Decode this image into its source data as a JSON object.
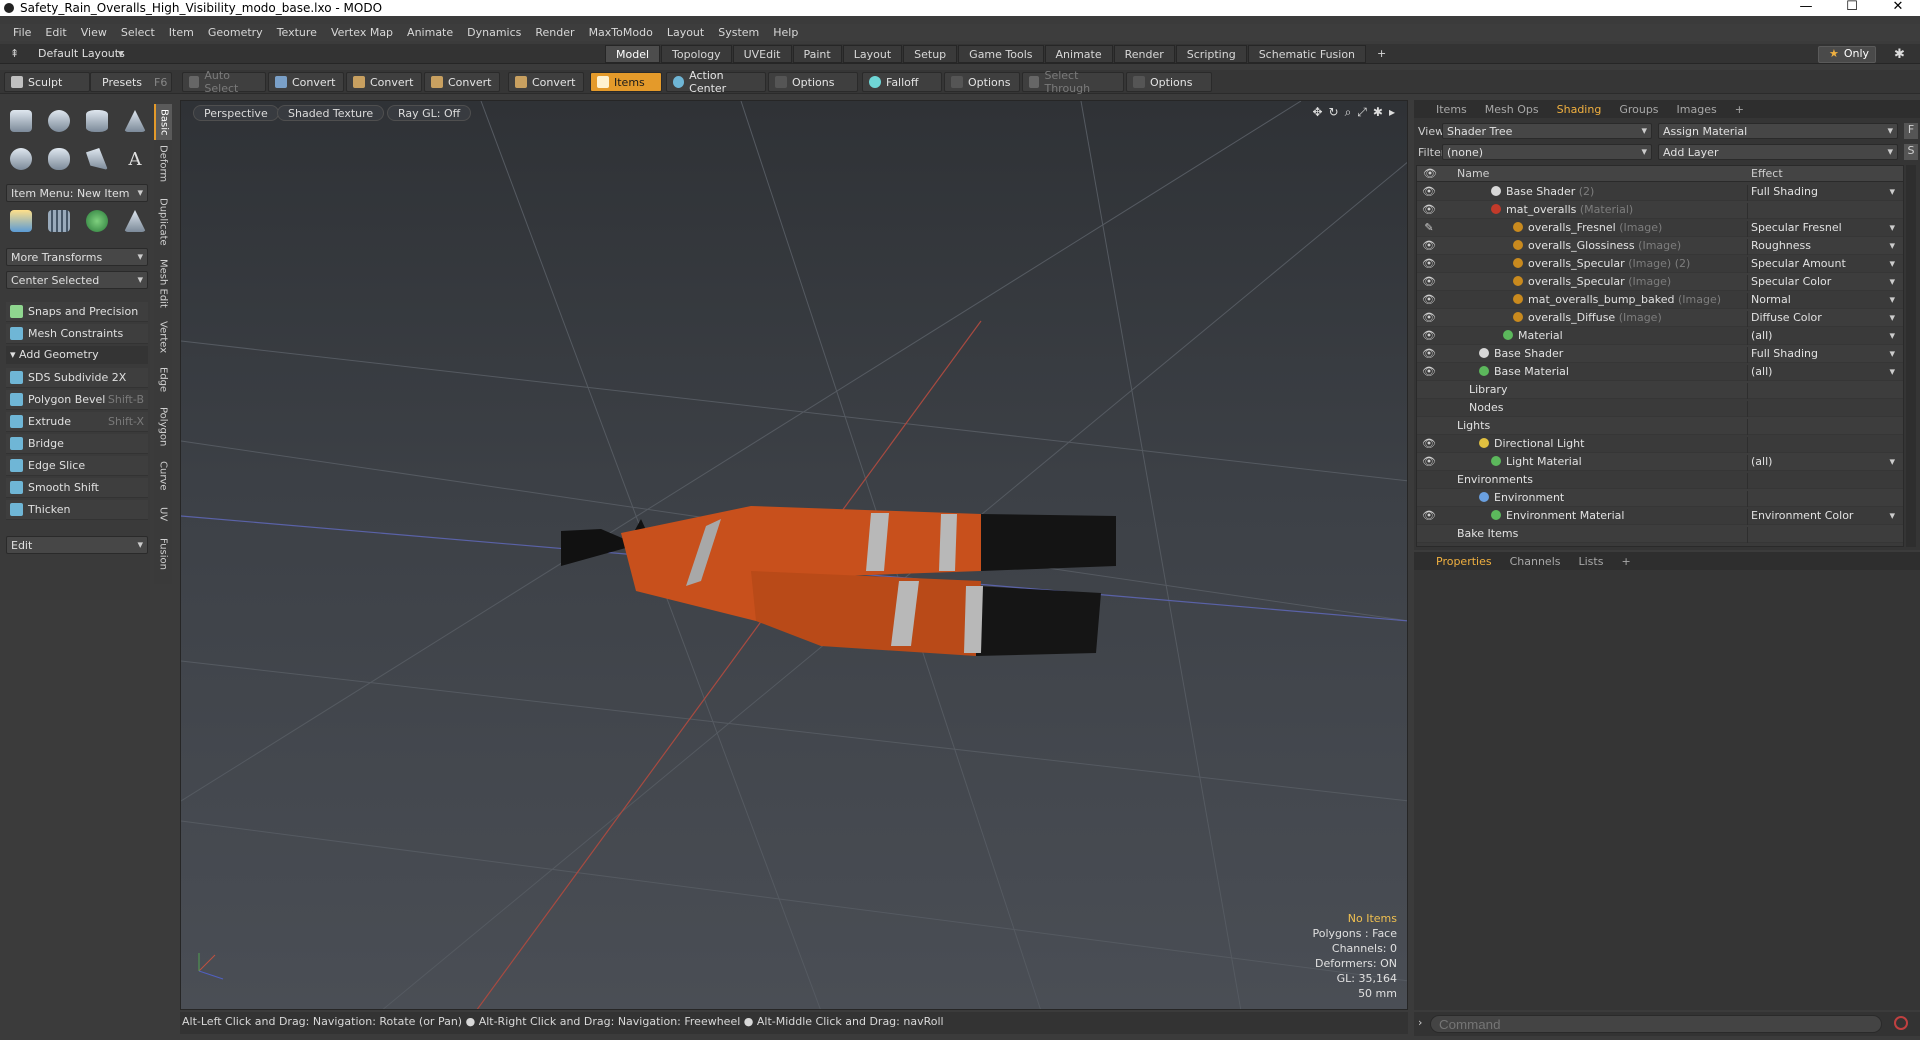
{
  "window": {
    "title": "Safety_Rain_Overalls_High_Visibility_modo_base.lxo - MODO",
    "controls": [
      "—",
      "☐",
      "✕"
    ]
  },
  "menu": [
    "File",
    "Edit",
    "View",
    "Select",
    "Item",
    "Geometry",
    "Texture",
    "Vertex Map",
    "Animate",
    "Dynamics",
    "Render",
    "MaxToModo",
    "Layout",
    "System",
    "Help"
  ],
  "layoutbar": {
    "layout_name": "Default Layouts",
    "tabs": [
      "Model",
      "Topology",
      "UVEdit",
      "Paint",
      "Layout",
      "Setup",
      "Game Tools",
      "Animate",
      "Render",
      "Scripting",
      "Schematic Fusion"
    ],
    "active_tab": "Model",
    "add": "+",
    "only_label": "Only",
    "only_star": "★",
    "gear": "✱"
  },
  "toolbar": {
    "sculpt": "Sculpt",
    "presets": "Presets",
    "presets_key": "F6",
    "auto_select": "Auto Select",
    "convert1": "Convert",
    "convert2": "Convert",
    "convert3": "Convert",
    "convert4": "Convert",
    "items": "Items",
    "action_center": "Action Center",
    "options1": "Options",
    "falloff": "Falloff",
    "options2": "Options",
    "select_through": "Select Through",
    "options3": "Options"
  },
  "left": {
    "vtabs": [
      "Basic",
      "Deform",
      "Duplicate",
      "Mesh Edit",
      "Vertex",
      "Edge",
      "Polygon",
      "Curve",
      "UV",
      "Fusion"
    ],
    "item_menu": "Item Menu: New Item",
    "more_transforms": "More Transforms",
    "center_selected": "Center Selected",
    "snaps": "Snaps and Precision",
    "mesh_constraints": "Mesh Constraints",
    "add_geometry": "Add Geometry",
    "tools": [
      {
        "label": "SDS Subdivide 2X",
        "key": ""
      },
      {
        "label": "Polygon Bevel",
        "key": "Shift-B"
      },
      {
        "label": "Extrude",
        "key": "Shift-X"
      },
      {
        "label": "Bridge",
        "key": ""
      },
      {
        "label": "Edge Slice",
        "key": ""
      },
      {
        "label": "Smooth Shift",
        "key": ""
      },
      {
        "label": "Thicken",
        "key": ""
      }
    ],
    "edit": "Edit"
  },
  "viewport": {
    "perspective": "Perspective",
    "shaded": "Shaded Texture",
    "raygl": "Ray GL: Off",
    "icons": [
      "✥",
      "↻",
      "⌕",
      "⤢",
      "✱",
      "▸"
    ],
    "info": {
      "items": "No Items",
      "polygons": "Polygons : Face",
      "channels": "Channels: 0",
      "deformers": "Deformers: ON",
      "gl": "GL: 35,164",
      "lens": "50 mm"
    }
  },
  "status": "Alt-Left Click and Drag: Navigation: Rotate (or Pan) ● Alt-Right Click and Drag: Navigation: Freewheel ● Alt-Middle Click and Drag: navRoll",
  "right": {
    "tabs": [
      "Items",
      "Mesh Ops",
      "Shading",
      "Groups",
      "Images",
      "+"
    ],
    "active_tab": "Shading",
    "view_label": "View",
    "view_value": "Shader Tree",
    "assign": "Assign Material",
    "filter_label": "Filter",
    "filter_value": "(none)",
    "add_layer": "Add Layer",
    "f_btn": "F",
    "s_btn": "S",
    "col_name": "Name",
    "col_effect": "Effect",
    "rows": [
      {
        "name": "Base Shader",
        "sub": "(2)",
        "effect": "Full Shading",
        "eye": "👁",
        "ball": "#d8d8d8",
        "indent": 74
      },
      {
        "name": "mat_overalls",
        "sub": "(Material)",
        "effect": "",
        "eye": "👁",
        "ball": "#c23a2a",
        "indent": 74
      },
      {
        "name": "overalls_Fresnel",
        "sub": "(Image)",
        "effect": "Specular Fresnel",
        "eye": "✎",
        "ball": "#c98a1e",
        "indent": 96
      },
      {
        "name": "overalls_Glossiness",
        "sub": "(Image)",
        "effect": "Roughness",
        "eye": "👁",
        "ball": "#c98a1e",
        "indent": 96
      },
      {
        "name": "overalls_Specular",
        "sub": "(Image) (2)",
        "effect": "Specular Amount",
        "eye": "👁",
        "ball": "#c98a1e",
        "indent": 96
      },
      {
        "name": "overalls_Specular",
        "sub": "(Image)",
        "effect": "Specular Color",
        "eye": "👁",
        "ball": "#c98a1e",
        "indent": 96
      },
      {
        "name": "mat_overalls_bump_baked",
        "sub": "(Image)",
        "effect": "Normal",
        "eye": "👁",
        "ball": "#c98a1e",
        "indent": 96
      },
      {
        "name": "overalls_Diffuse",
        "sub": "(Image)",
        "effect": "Diffuse Color",
        "eye": "👁",
        "ball": "#c98a1e",
        "indent": 96
      },
      {
        "name": "Material",
        "sub": "",
        "effect": "(all)",
        "eye": "👁",
        "ball": "#5cb85c",
        "indent": 86
      },
      {
        "name": "Base Shader",
        "sub": "",
        "effect": "Full Shading",
        "eye": "👁",
        "ball": "#d8d8d8",
        "indent": 62
      },
      {
        "name": "Base Material",
        "sub": "",
        "effect": "(all)",
        "eye": "👁",
        "ball": "#5cb85c",
        "indent": 62
      },
      {
        "name": "Library",
        "sub": "",
        "effect": "",
        "eye": "",
        "ball": "",
        "indent": 52
      },
      {
        "name": "Nodes",
        "sub": "",
        "effect": "",
        "eye": "",
        "ball": "",
        "indent": 52
      },
      {
        "name": "Lights",
        "sub": "",
        "effect": "",
        "eye": "",
        "ball": "",
        "indent": 40
      },
      {
        "name": "Directional Light",
        "sub": "",
        "effect": "",
        "eye": "👁",
        "ball": "#e0c040",
        "indent": 62
      },
      {
        "name": "Light Material",
        "sub": "",
        "effect": "(all)",
        "eye": "👁",
        "ball": "#5cb85c",
        "indent": 74
      },
      {
        "name": "Environments",
        "sub": "",
        "effect": "",
        "eye": "",
        "ball": "",
        "indent": 40
      },
      {
        "name": "Environment",
        "sub": "",
        "effect": "",
        "eye": "",
        "ball": "#6aa0e0",
        "indent": 62
      },
      {
        "name": "Environment Material",
        "sub": "",
        "effect": "Environment Color",
        "eye": "👁",
        "ball": "#5cb85c",
        "indent": 74
      },
      {
        "name": "Bake Items",
        "sub": "",
        "effect": "",
        "eye": "",
        "ball": "",
        "indent": 40
      }
    ],
    "lower_tabs": [
      "Properties",
      "Channels",
      "Lists",
      "+"
    ],
    "lower_active": "Properties"
  },
  "command": {
    "placeholder": "Command"
  }
}
